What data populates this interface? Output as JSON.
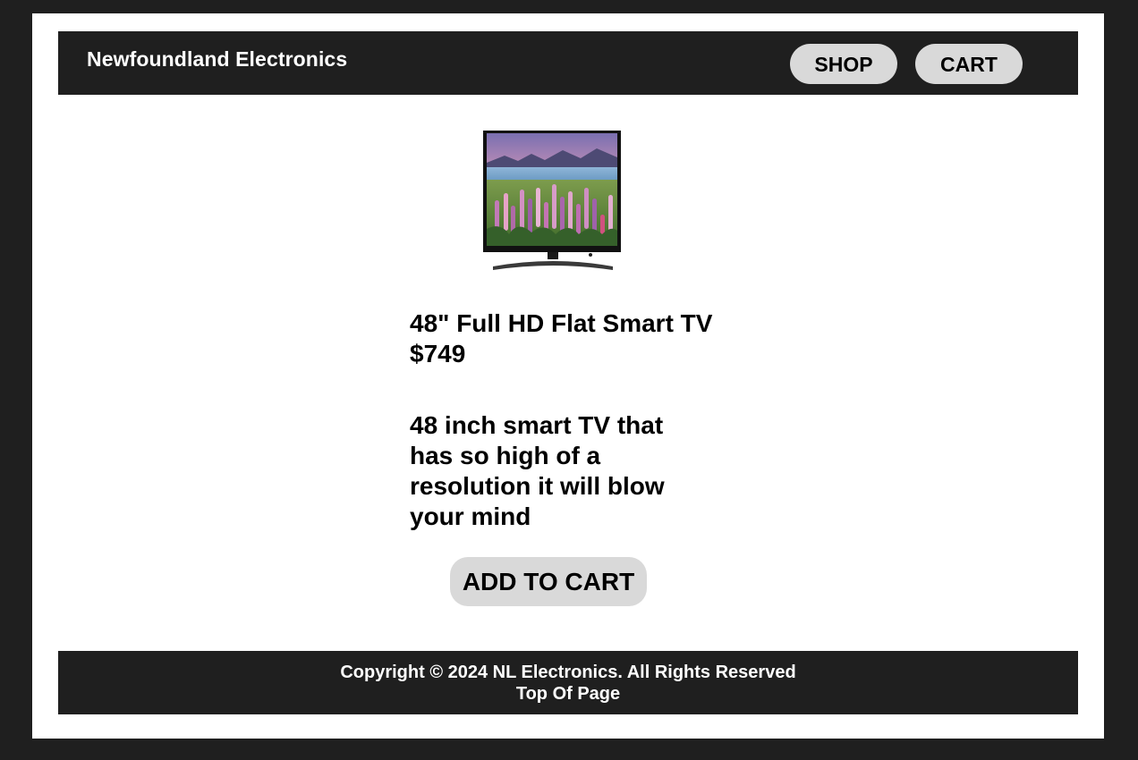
{
  "header": {
    "site_title": "Newfoundland Electronics",
    "nav": {
      "shop_label": "SHOP",
      "cart_label": "CART"
    }
  },
  "product": {
    "image_icon": "tv-product-image",
    "name": "48\" Full HD Flat Smart TV",
    "price": "$749",
    "description": "48 inch smart TV that has so high of a resolution it will blow your mind",
    "add_to_cart_label": "ADD TO CART"
  },
  "footer": {
    "copyright": "Copyright © 2024 NL Electronics. All Rights Reserved",
    "top_link": "Top Of Page"
  },
  "colors": {
    "page_background": "#1f1f1f",
    "content_background": "#ffffff",
    "bar_background": "#1f1f1f",
    "button_background": "#d9d9d9"
  }
}
